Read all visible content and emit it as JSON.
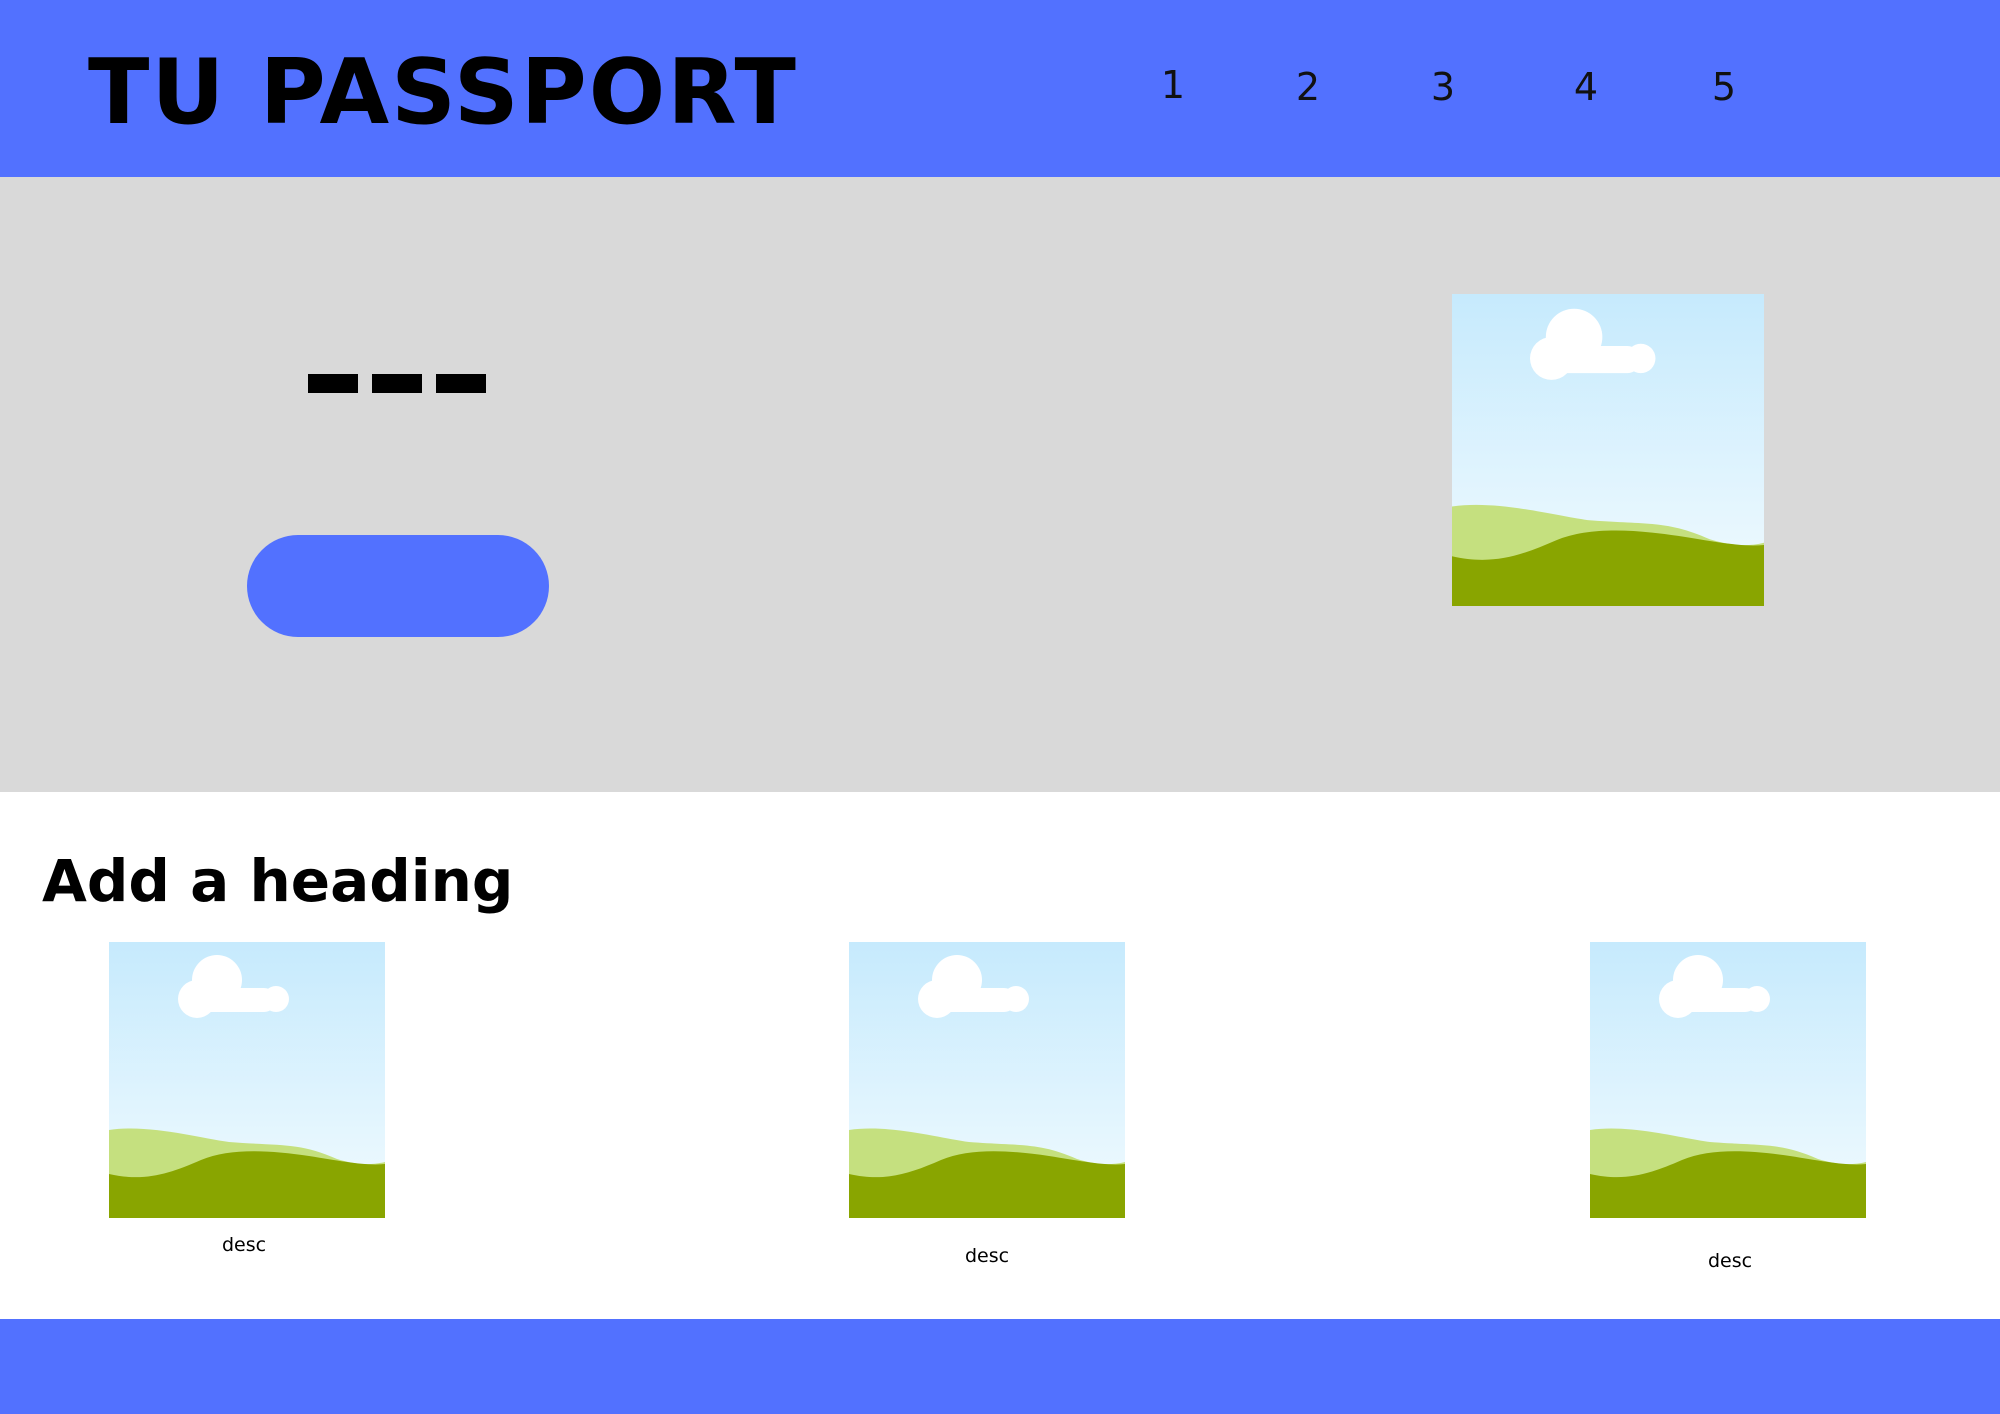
{
  "colors": {
    "brand": "#5271ff",
    "hero_bg": "#d9d9d9",
    "page_bg": "#ffffff"
  },
  "header": {
    "title": "TU PASSPORT",
    "nav": [
      "1",
      "2",
      "3",
      "4",
      "5"
    ]
  },
  "hero": {
    "placeholder_text": "---",
    "button_label": "",
    "image_icon": "landscape-image-icon"
  },
  "gallery": {
    "heading": "Add a heading",
    "items": [
      {
        "image_icon": "landscape-image-icon",
        "desc": "desc"
      },
      {
        "image_icon": "landscape-image-icon",
        "desc": "desc"
      },
      {
        "image_icon": "landscape-image-icon",
        "desc": "desc"
      }
    ]
  }
}
